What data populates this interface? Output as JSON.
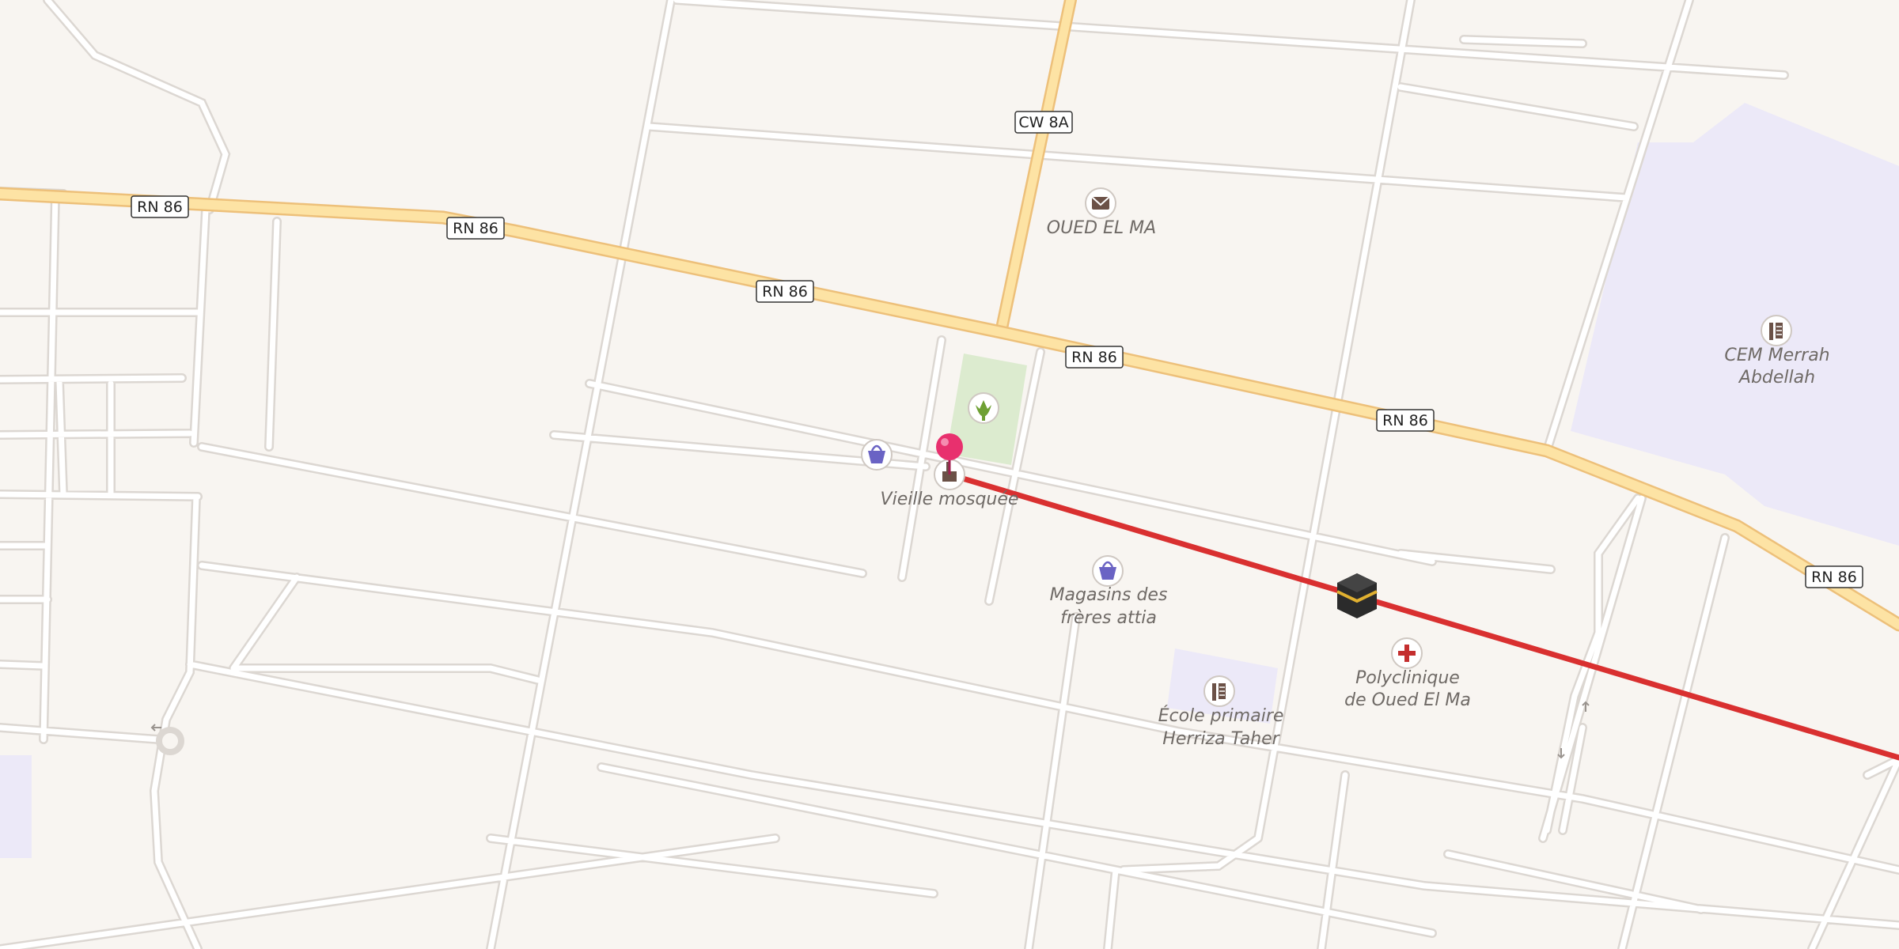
{
  "map": {
    "road_shields": {
      "rn86": "RN 86",
      "cw8a": "CW 8A"
    },
    "places": {
      "oued_el_ma": "OUED EL MA",
      "vieille_mosquee": "Vieille mosquée",
      "magasins_line1": "Magasins des",
      "magasins_line2": "frères attia",
      "polyclinique_line1": "Polyclinique",
      "polyclinique_line2": "de Oued El Ma",
      "ecole_line1": "École primaire",
      "ecole_line2": "Herriza Taher",
      "cem_line1": "CEM Merrah",
      "cem_line2": "Abdellah"
    },
    "icons": [
      "post-office-icon",
      "garden-icon",
      "shop-icon",
      "mosque-icon",
      "location-pin-icon",
      "kaaba-icon",
      "hospital-icon",
      "school-icon"
    ],
    "colors": {
      "background": "#f8f5f1",
      "main_road": "#fde3a4",
      "main_road_casing": "#edc07a",
      "minor_road": "#ffffff",
      "minor_road_casing": "#dcd7d2",
      "qibla_line": "#d93030",
      "pin": "#e8306e",
      "school_area": "#ece9f8",
      "park": "#dcebcf"
    }
  }
}
